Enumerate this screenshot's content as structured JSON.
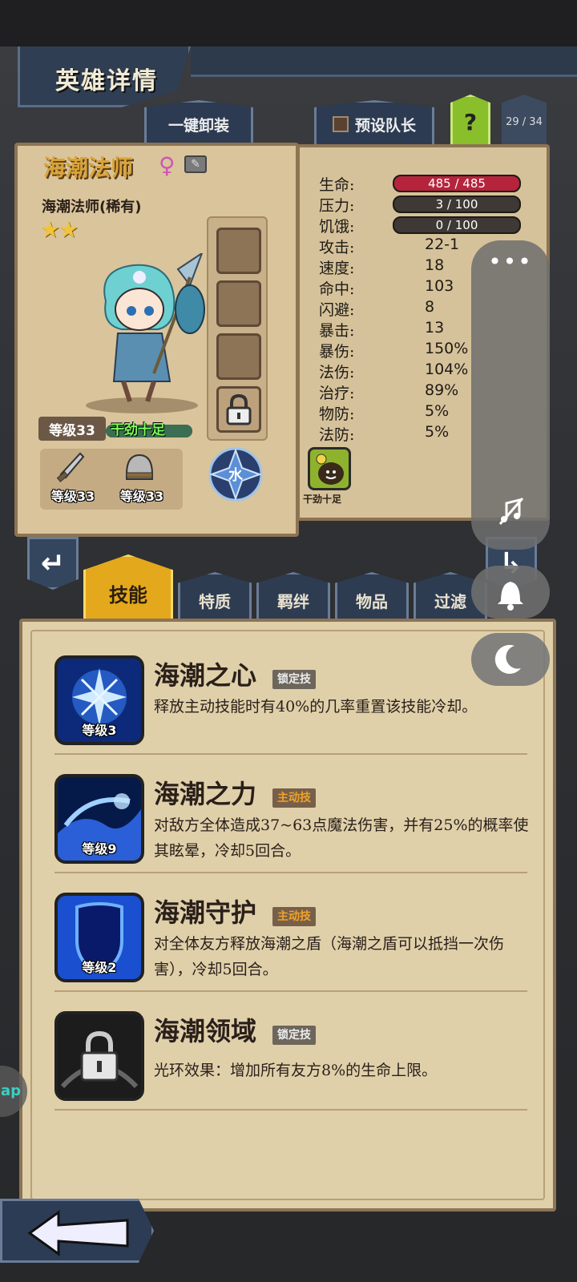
{
  "header": {
    "title": "英雄详情",
    "unequip_label": "一键卸装",
    "preset_label": "预设队长",
    "help_label": "?",
    "hero_count": "29 / 34"
  },
  "hero": {
    "name": "海潮法师",
    "gender_symbol": "♀",
    "subtitle": "海潮法师(稀有)",
    "stars": "★★",
    "level": "等级33",
    "mood": "干劲十足",
    "weapon_level": "等级33",
    "armor_level": "等级33",
    "element": "水"
  },
  "stats": {
    "hp_label": "生命:",
    "hp_value": "485 / 485",
    "stress_label": "压力:",
    "stress_value": "3 / 100",
    "hunger_label": "饥饿:",
    "hunger_value": "0 / 100",
    "rows": [
      {
        "label": "攻击:",
        "value": "22-1"
      },
      {
        "label": "速度:",
        "value": "18"
      },
      {
        "label": "命中:",
        "value": "103"
      },
      {
        "label": "闪避:",
        "value": "8"
      },
      {
        "label": "暴击:",
        "value": "13"
      },
      {
        "label": "暴伤:",
        "value": "150%"
      },
      {
        "label": "法伤:",
        "value": "104%"
      },
      {
        "label": "治疗:",
        "value": "89%"
      },
      {
        "label": "物防:",
        "value": "5%"
      },
      {
        "label": "法防:",
        "value": "5%"
      }
    ],
    "trait_label": "干劲十足"
  },
  "tabs": [
    "技能",
    "特质",
    "羁绊",
    "物品",
    "过滤"
  ],
  "skills": [
    {
      "name": "海潮之心",
      "tag": "锁定技",
      "level": "等级3",
      "desc": "释放主动技能时有40%的几率重置该技能冷却。"
    },
    {
      "name": "海潮之力",
      "tag": "主动技",
      "level": "等级9",
      "desc": "对敌方全体造成37~63点魔法伤害，并有25%的概率使其眩晕，冷却5回合。"
    },
    {
      "name": "海潮守护",
      "tag": "主动技",
      "level": "等级2",
      "desc": "对全体友方释放海潮之盾（海潮之盾可以抵挡一次伤害），冷却5回合。"
    },
    {
      "name": "海潮领域",
      "tag": "锁定技",
      "level": "",
      "desc": "光环效果：增加所有友方8%的生命上限。"
    }
  ],
  "overlay": {
    "dots": "•••",
    "side_text": "ap"
  },
  "colors": {
    "accent": "#e4a81c",
    "hp_bar": "#b5243b",
    "active_tag": "#f0a22a",
    "mood_text": "#7cff5a"
  }
}
